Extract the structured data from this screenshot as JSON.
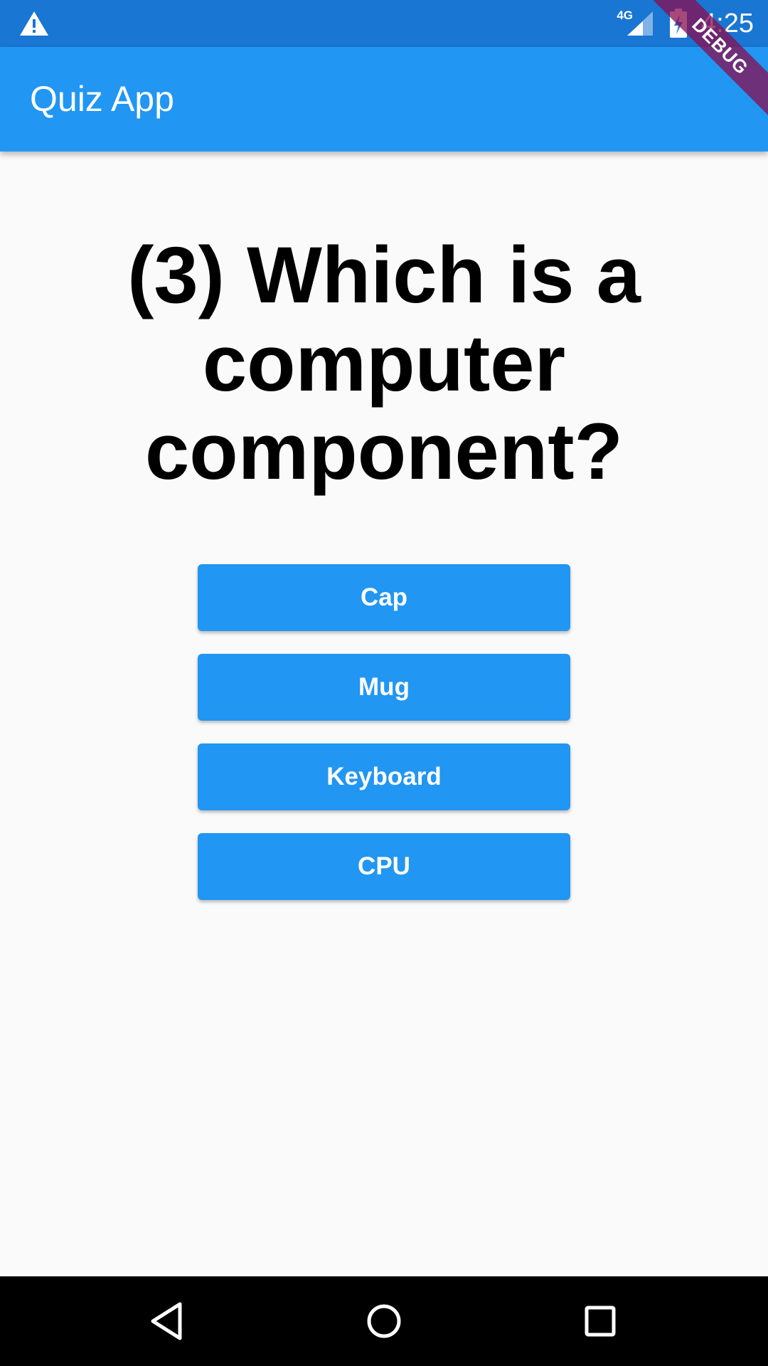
{
  "status_bar": {
    "network_type": "4G",
    "time": "4:25",
    "icons": [
      "warning-icon",
      "signal-icon",
      "battery-charging-icon"
    ]
  },
  "app_bar": {
    "title": "Quiz App"
  },
  "debug_banner": {
    "label": "DEBUG"
  },
  "quiz": {
    "question": "(3) Which is a computer component?",
    "answers": [
      "Cap",
      "Mug",
      "Keyboard",
      "CPU"
    ]
  },
  "nav_bar": {
    "icons": [
      "back-icon",
      "home-icon",
      "recents-icon"
    ]
  },
  "colors": {
    "status_bar": "#1976d2",
    "primary": "#2196f3",
    "background": "#fafafa",
    "debug_banner": "#880e4f",
    "nav_bar": "#000000"
  }
}
